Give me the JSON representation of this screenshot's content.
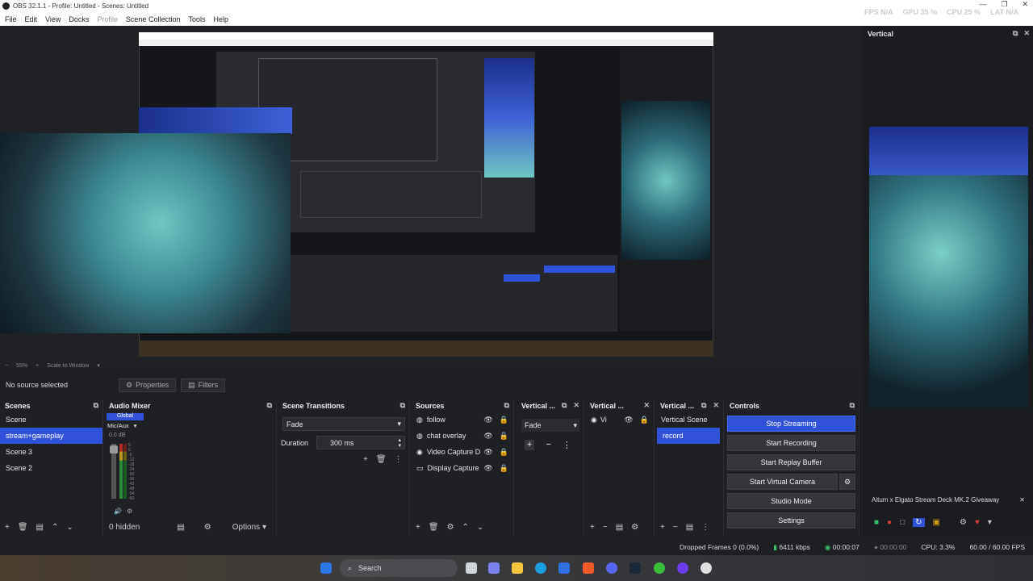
{
  "window": {
    "title": "OBS 32.1.1 - Profile: Untitled - Scenes: Untitled",
    "minimize": "—",
    "maximize": "❐",
    "close": "✕"
  },
  "menu": [
    "File",
    "Edit",
    "View",
    "Docks",
    "Profile",
    "Scene Collection",
    "Tools",
    "Help"
  ],
  "stats": {
    "fps_label": "FPS",
    "fps": "N/A",
    "gpu_label": "GPU",
    "gpu": "35 %",
    "cpu_label": "CPU",
    "cpu": "25 %",
    "lat_label": "LAT",
    "lat": "N/A"
  },
  "zoom": {
    "level": "55%",
    "mode": "Scale to Window"
  },
  "vertical_dock": {
    "title": "Vertical",
    "giveaway": "Aitum x Elgato Stream Deck MK.2 Giveaway"
  },
  "source_toolbar": {
    "no_source": "No source selected",
    "properties": "Properties",
    "filters": "Filters"
  },
  "scenes": {
    "title": "Scenes",
    "items": [
      "Scene",
      "stream+gameplay",
      "Scene 3",
      "Scene 2"
    ],
    "selected": 1
  },
  "audio_mixer": {
    "title": "Audio Mixer",
    "global": "Global",
    "channel": "Mic/Aux",
    "db": "0.0 dB",
    "scale": [
      "5",
      "0",
      "-6",
      "-12",
      "-18",
      "-24",
      "-30",
      "-36",
      "-42",
      "-48",
      "-54",
      "-60"
    ],
    "hidden": "0 hidden",
    "options": "Options"
  },
  "scene_transitions": {
    "title": "Scene Transitions",
    "transition": "Fade",
    "duration_label": "Duration",
    "duration": "300 ms"
  },
  "sources": {
    "title": "Sources",
    "items": [
      {
        "name": "follow",
        "icon": "globe-icon"
      },
      {
        "name": "chat overlay",
        "icon": "globe-icon"
      },
      {
        "name": "Video Capture D",
        "icon": "camera-icon"
      },
      {
        "name": "Display Capture",
        "icon": "monitor-icon"
      }
    ]
  },
  "vertical_transitions": {
    "title": "Vertical ...",
    "transition": "Fade"
  },
  "vertical_sources": {
    "title": "Vertical ...",
    "item": "Vi"
  },
  "vertical_scenes": {
    "title": "Vertical ...",
    "items": [
      "Vertical Scene",
      "record"
    ],
    "selected": 1
  },
  "controls": {
    "title": "Controls",
    "stop_streaming": "Stop Streaming",
    "start_recording": "Start Recording",
    "start_replay": "Start Replay Buffer",
    "start_virtual_cam": "Start Virtual Camera",
    "studio_mode": "Studio Mode",
    "settings": "Settings"
  },
  "status": {
    "dropped": "Dropped Frames 0 (0.0%)",
    "bitrate": "6411 kbps",
    "stream_time": "00:00:07",
    "rec_time": "00:00:00",
    "cpu": "CPU: 3.3%",
    "fps": "60.00 / 60.00 FPS"
  },
  "taskbar": {
    "search": "Search"
  },
  "colors": {
    "accent": "#2f52d9",
    "panel": "#1f2024",
    "background": "#1e1f23"
  }
}
